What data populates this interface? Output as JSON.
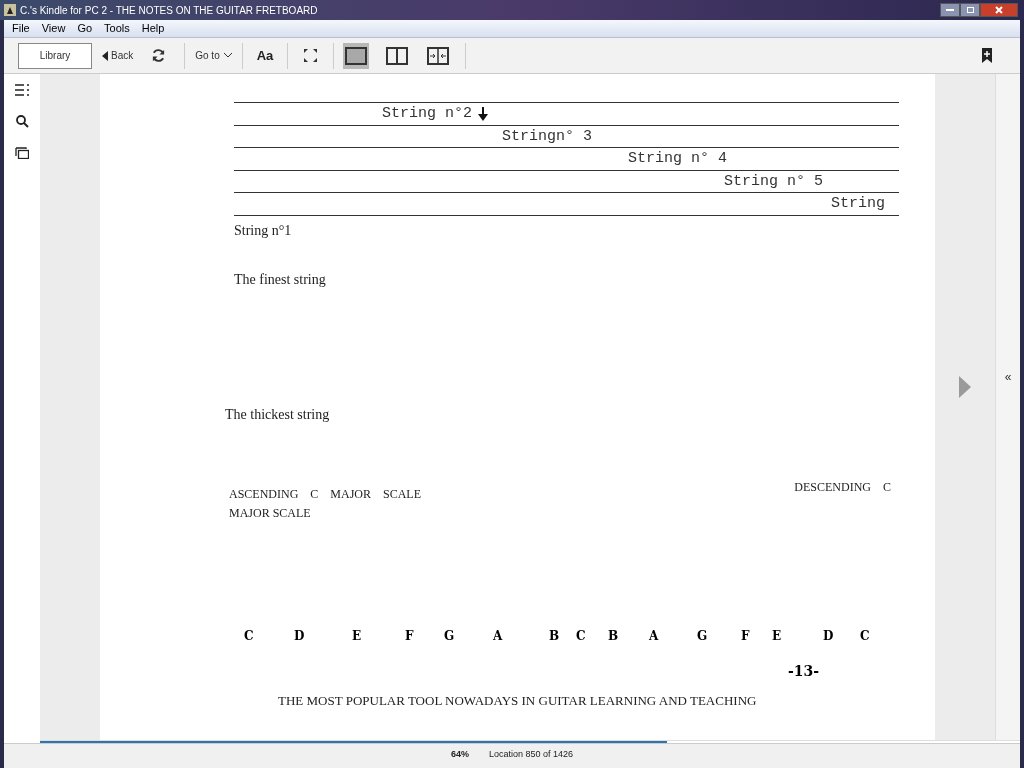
{
  "window": {
    "title": "C.'s Kindle for PC 2 - THE NOTES ON THE GUITAR FRETBOARD"
  },
  "menu": [
    "File",
    "View",
    "Go",
    "Tools",
    "Help"
  ],
  "toolbar": {
    "library": "Library",
    "back": "Back",
    "goto": "Go to",
    "font": "Aa",
    "layouts": [
      {
        "kind": "single",
        "selected": true
      },
      {
        "kind": "double",
        "selected": false
      },
      {
        "kind": "fit",
        "selected": false
      }
    ]
  },
  "page": {
    "strings": [
      {
        "label": "String n°2",
        "arrow": true
      },
      {
        "label": "Stringn° 3",
        "arrow": false
      },
      {
        "label": "String n° 4",
        "arrow": false
      },
      {
        "label": "String n° 5",
        "arrow": false
      },
      {
        "label": "String",
        "arrow": false
      }
    ],
    "first_string": "String n°1",
    "finest": "The finest string",
    "thickest": "The thickest string",
    "ascending": "ASCENDING    C    MAJOR    SCALE MAJOR SCALE",
    "descending": "DESCENDING    C",
    "notes": [
      "C",
      "D",
      "E",
      "F",
      "G",
      "A",
      "B",
      "C",
      "B",
      "A",
      "G",
      "F",
      "E",
      "D",
      "C"
    ],
    "page_number": "-13-",
    "footer": "THE MOST POPULAR TOOL NOWADAYS IN GUITAR LEARNING AND TEACHING"
  },
  "right_panel": {
    "toggle": "«"
  },
  "progress": {
    "level": 0.64
  },
  "status_bar": {
    "percent": "64%",
    "location": "Location 850 of 1426"
  }
}
